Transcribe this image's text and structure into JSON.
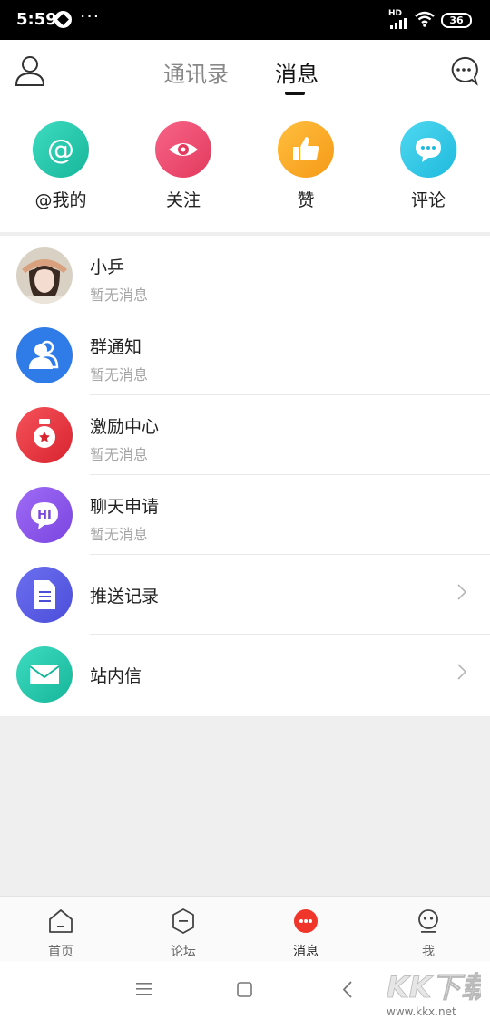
{
  "status_bar": {
    "time": "5:59",
    "dots": "···",
    "hd": "HD",
    "battery": "36"
  },
  "header": {
    "tabs": [
      {
        "label": "通讯录"
      },
      {
        "label": "消息"
      }
    ],
    "active_tab": "消息"
  },
  "quick_actions": [
    {
      "label": "@我的",
      "icon": "at-icon",
      "color": "#23c9a9"
    },
    {
      "label": "关注",
      "icon": "eye-icon",
      "color": "#f04a6e"
    },
    {
      "label": "赞",
      "icon": "thumbs-up-icon",
      "color": "#fbaa26"
    },
    {
      "label": "评论",
      "icon": "comment-icon",
      "color": "#2dc9e6"
    }
  ],
  "message_list": [
    {
      "title": "小乒",
      "subtitle": "暂无消息",
      "icon": "user-avatar"
    },
    {
      "title": "群通知",
      "subtitle": "暂无消息",
      "icon": "group-icon",
      "color": "#2f7be8"
    },
    {
      "title": "激励中心",
      "subtitle": "暂无消息",
      "icon": "medal-icon",
      "color": "#ea3a4a"
    },
    {
      "title": "聊天申请",
      "subtitle": "暂无消息",
      "icon": "hi-chat-icon",
      "color": "#8a57ec",
      "icon_text": "HI"
    },
    {
      "title": "推送记录",
      "icon": "document-icon",
      "color": "#5b5ee6"
    },
    {
      "title": "站内信",
      "icon": "envelope-icon",
      "color": "#23c9a9"
    }
  ],
  "bottom_nav": [
    {
      "label": "首页",
      "icon": "home-icon"
    },
    {
      "label": "论坛",
      "icon": "forum-icon"
    },
    {
      "label": "消息",
      "icon": "message-icon",
      "active": true
    },
    {
      "label": "我",
      "icon": "profile-icon"
    }
  ],
  "watermark": {
    "brand": "KK下载",
    "url": "www.kkx.net"
  },
  "colors": {
    "accent_red": "#f0352a",
    "page_bg": "#efefef"
  }
}
